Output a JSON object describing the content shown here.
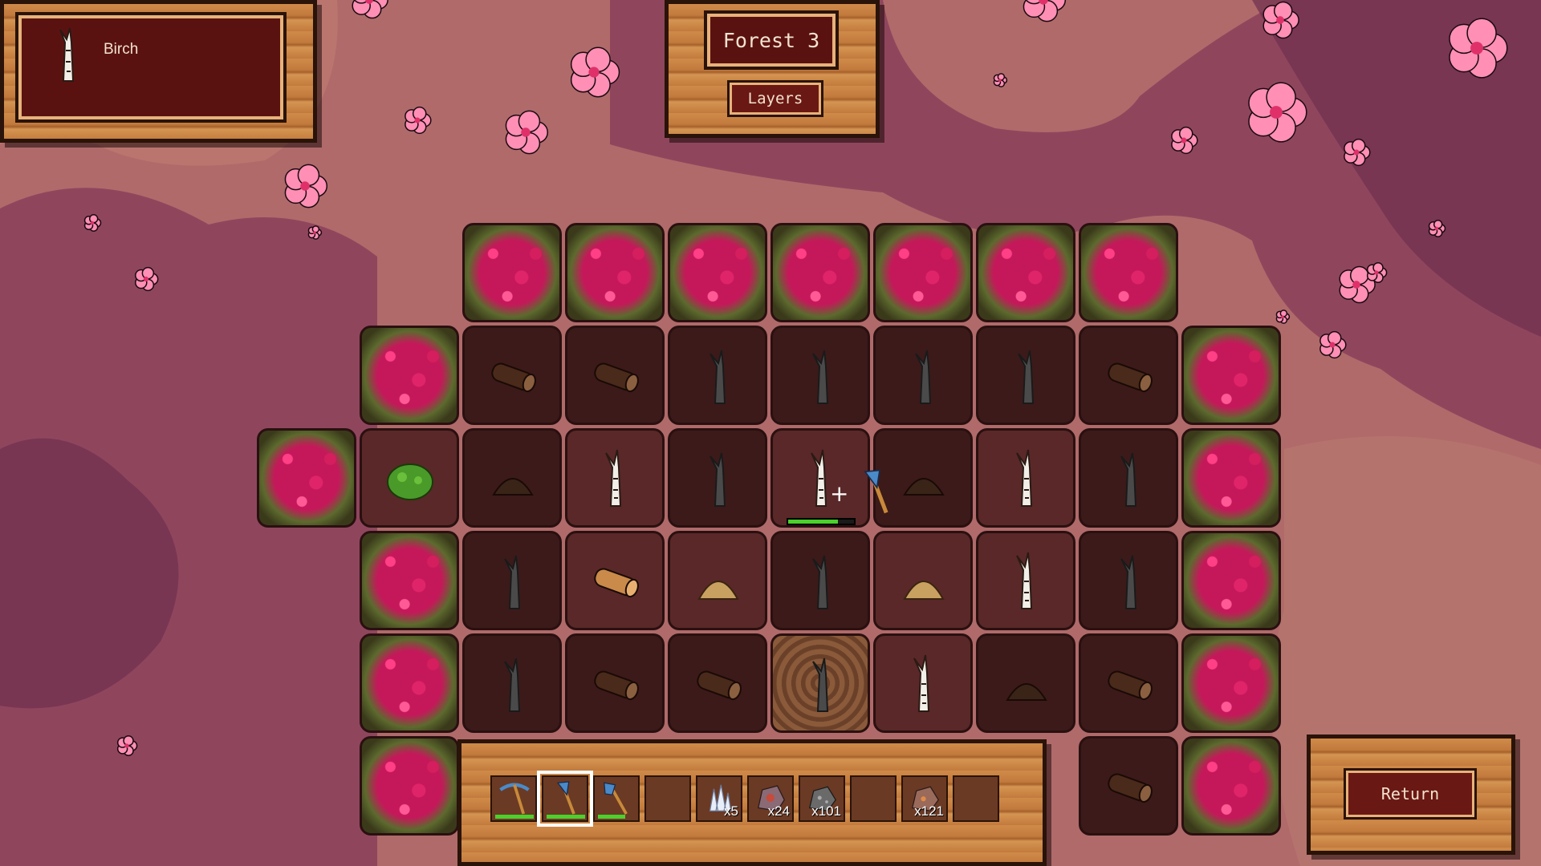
{
  "selected_item": {
    "name": "Birch",
    "icon": "birch-sapling-icon"
  },
  "location": {
    "title": "Forest 3",
    "layers_label": "Layers"
  },
  "return_label": "Return",
  "colors": {
    "ground": "#b06a6a",
    "shade": "#6e3050",
    "wood": "#c27a3c",
    "plate": "#5a1210",
    "blossom": "#ff8fb5",
    "durability": "#4cd02c"
  },
  "grid": {
    "rows": [
      [
        null,
        null,
        "bush",
        "bush",
        "bush",
        "bush",
        "bush",
        "bush",
        "bush",
        null
      ],
      [
        null,
        "bush",
        "log",
        "log",
        "dead-tree",
        "dead-tree",
        "dead-tree",
        "dead-tree",
        "log",
        "bush"
      ],
      [
        "bush",
        "shrub",
        "dirt",
        "birch",
        "dead-tree",
        "birch",
        "dirt",
        "birch",
        "dead-tree",
        "bush"
      ],
      [
        null,
        "bush",
        "dead-tree",
        "birch-log",
        "sand",
        "dead-tree",
        "sand",
        "birch",
        "dead-tree",
        "bush"
      ],
      [
        null,
        "bush",
        "dead-tree",
        "log",
        "log",
        "stump",
        "birch",
        "dirt",
        "log",
        "bush"
      ],
      [
        null,
        "bush",
        null,
        null,
        null,
        null,
        null,
        null,
        "log",
        "bush"
      ]
    ]
  },
  "cursor": {
    "tile_row": 2,
    "tile_col": 5,
    "progress": 0.75
  },
  "hotbar": {
    "slots": [
      {
        "item": "pickaxe-icon",
        "count": "",
        "durability": 1.0
      },
      {
        "item": "axe-icon",
        "count": "",
        "durability": 1.0,
        "selected": true
      },
      {
        "item": "shovel-icon",
        "count": "",
        "durability": 0.7
      },
      {
        "item": "",
        "count": ""
      },
      {
        "item": "quartz-icon",
        "count": "x5"
      },
      {
        "item": "iron-ore-icon",
        "count": "x24"
      },
      {
        "item": "stone-icon",
        "count": "x101"
      },
      {
        "item": "",
        "count": ""
      },
      {
        "item": "copper-ore-icon",
        "count": "x121"
      },
      {
        "item": "",
        "count": ""
      }
    ]
  }
}
